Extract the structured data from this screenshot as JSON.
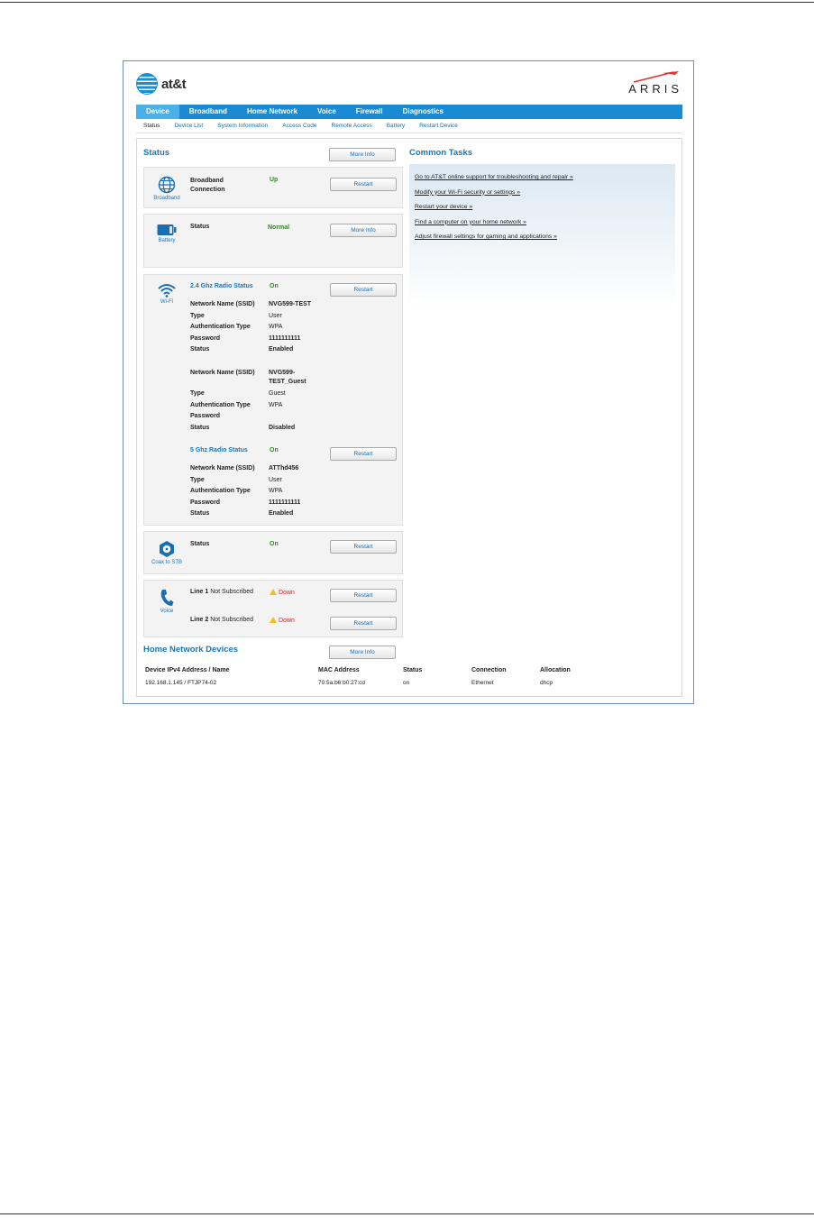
{
  "header": {
    "att_logo_text": "at&t",
    "arris_logo_text": "ARRIS"
  },
  "mainnav": [
    "Device",
    "Broadband",
    "Home Network",
    "Voice",
    "Firewall",
    "Diagnostics"
  ],
  "subnav": [
    "Status",
    "Device List",
    "System Information",
    "Access Code",
    "Remote Access",
    "Battery",
    "Restart Device"
  ],
  "status": {
    "title": "Status",
    "more_info": "More Info",
    "broadband": {
      "icon_label": "Broadband",
      "label": "Broadband Connection",
      "value": "Up",
      "button": "Restart"
    },
    "battery": {
      "icon_label": "Battery",
      "label": "Status",
      "value": "Normal",
      "button": "More Info"
    },
    "wifi": {
      "icon_label": "Wi-Fi",
      "radio24_label": "2.4 Ghz Radio Status",
      "radio24_value": "On",
      "radio24_button": "Restart",
      "net1": {
        "ssid_label": "Network Name (SSID)",
        "ssid": "NVG599-TEST",
        "type_label": "Type",
        "type": "User",
        "auth_label": "Authentication Type",
        "auth": "WPA",
        "pw_label": "Password",
        "pw": "1111111111",
        "status_label": "Status",
        "status": "Enabled"
      },
      "net2": {
        "ssid_label": "Network Name (SSID)",
        "ssid_line1": "NVG599-",
        "ssid_line2": "TEST_Guest",
        "type_label": "Type",
        "type": "Guest",
        "auth_label": "Authentication Type",
        "auth": "WPA",
        "pw_label": "Password",
        "status_label": "Status",
        "status": "Disabled"
      },
      "radio5_label": "5 Ghz Radio Status",
      "radio5_value": "On",
      "radio5_button": "Restart",
      "net3": {
        "ssid_label": "Network Name (SSID)",
        "ssid": "ATThd456",
        "type_label": "Type",
        "type": "User",
        "auth_label": "Authentication Type",
        "auth": "WPA",
        "pw_label": "Password",
        "pw": "1111111111",
        "status_label": "Status",
        "status": "Enabled"
      }
    },
    "coax": {
      "icon_label": "Coax to STB",
      "label": "Status",
      "value": "On",
      "button": "Restart"
    },
    "voice": {
      "icon_label": "Voice",
      "line1_label": "Line 1",
      "line1_sub": "Not Subscribed",
      "line1_value": "Down",
      "line1_button": "Restart",
      "line2_label": "Line 2",
      "line2_sub": "Not Subscribed",
      "line2_value": "Down",
      "line2_button": "Restart"
    }
  },
  "common_tasks": {
    "title": "Common Tasks",
    "links": [
      "Go to AT&T online support for troubleshooting and repair »",
      "Modify your Wi-Fi security or settings »",
      "Restart your device »",
      "Find a computer on your home network »",
      "Adjust firewall settings for gaming and applications »"
    ]
  },
  "home_network": {
    "title": "Home Network Devices",
    "more_info": "More Info",
    "columns": [
      "Device IPv4 Address / Name",
      "MAC Address",
      "Status",
      "Connection",
      "Allocation"
    ],
    "rows": [
      [
        "192.168.1.145 / FTJP74-02",
        "70:5a:b6:b0:27:cd",
        "on",
        "Ethernet",
        "dhcp"
      ]
    ]
  },
  "colors": {
    "nav_blue": "#1a8ad2",
    "heading_blue": "#1a75bb",
    "status_green": "#2e8b1e",
    "down_red": "#d22222"
  }
}
